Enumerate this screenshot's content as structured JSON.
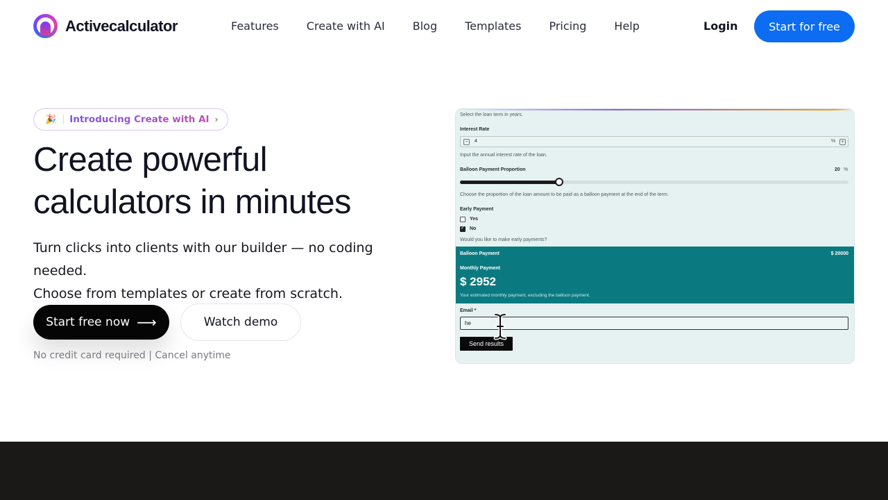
{
  "brand": {
    "name": "Activecalculator",
    "primary_color": "#0c6cf2",
    "logo_icon": "activecalculator-logo-icon"
  },
  "nav": {
    "links": [
      "Features",
      "Create with AI",
      "Blog",
      "Templates",
      "Pricing",
      "Help"
    ],
    "login": "Login",
    "cta": "Start for free"
  },
  "hero": {
    "badge_emoji": "🎉",
    "badge_text": "Introducing Create with AI",
    "badge_chevron": "›",
    "title_line1": "Create powerful",
    "title_line2": "calculators in minutes",
    "subtitle_line1": "Turn clicks into clients with our builder — no coding needed.",
    "subtitle_line2": "Choose from templates or create from scratch.",
    "primary_button": "Start free now",
    "primary_arrow": "⟶",
    "secondary_button": "Watch demo",
    "note": "No credit card required | Cancel anytime"
  },
  "preview": {
    "loan_term_help": "Select the loan term in years.",
    "interest_label": "Interest Rate",
    "interest_value": "4",
    "interest_unit": "%",
    "stepper_minus": "−",
    "stepper_plus": "+",
    "interest_help": "Input the annual interest rate of the loan.",
    "balloon_label": "Balloon Payment Proportion",
    "balloon_value": "20",
    "balloon_unit": "%",
    "balloon_fraction": 0.255,
    "balloon_help": "Choose the proportion of the loan amount to be paid as a balloon payment at the end of the term.",
    "early_label": "Early Payment",
    "early_yes": "Yes",
    "early_no": "No",
    "early_help": "Would you like to make early payments?",
    "result_balloon_label": "Balloon Payment",
    "result_balloon_value": "$ 20000",
    "result_monthly_label": "Monthly Payment",
    "result_monthly_value": "$ 2952",
    "result_monthly_help": "Your estimated monthly payment, excluding the balloon payment.",
    "email_label": "Email *",
    "email_value": "he",
    "send_button": "Send results"
  }
}
